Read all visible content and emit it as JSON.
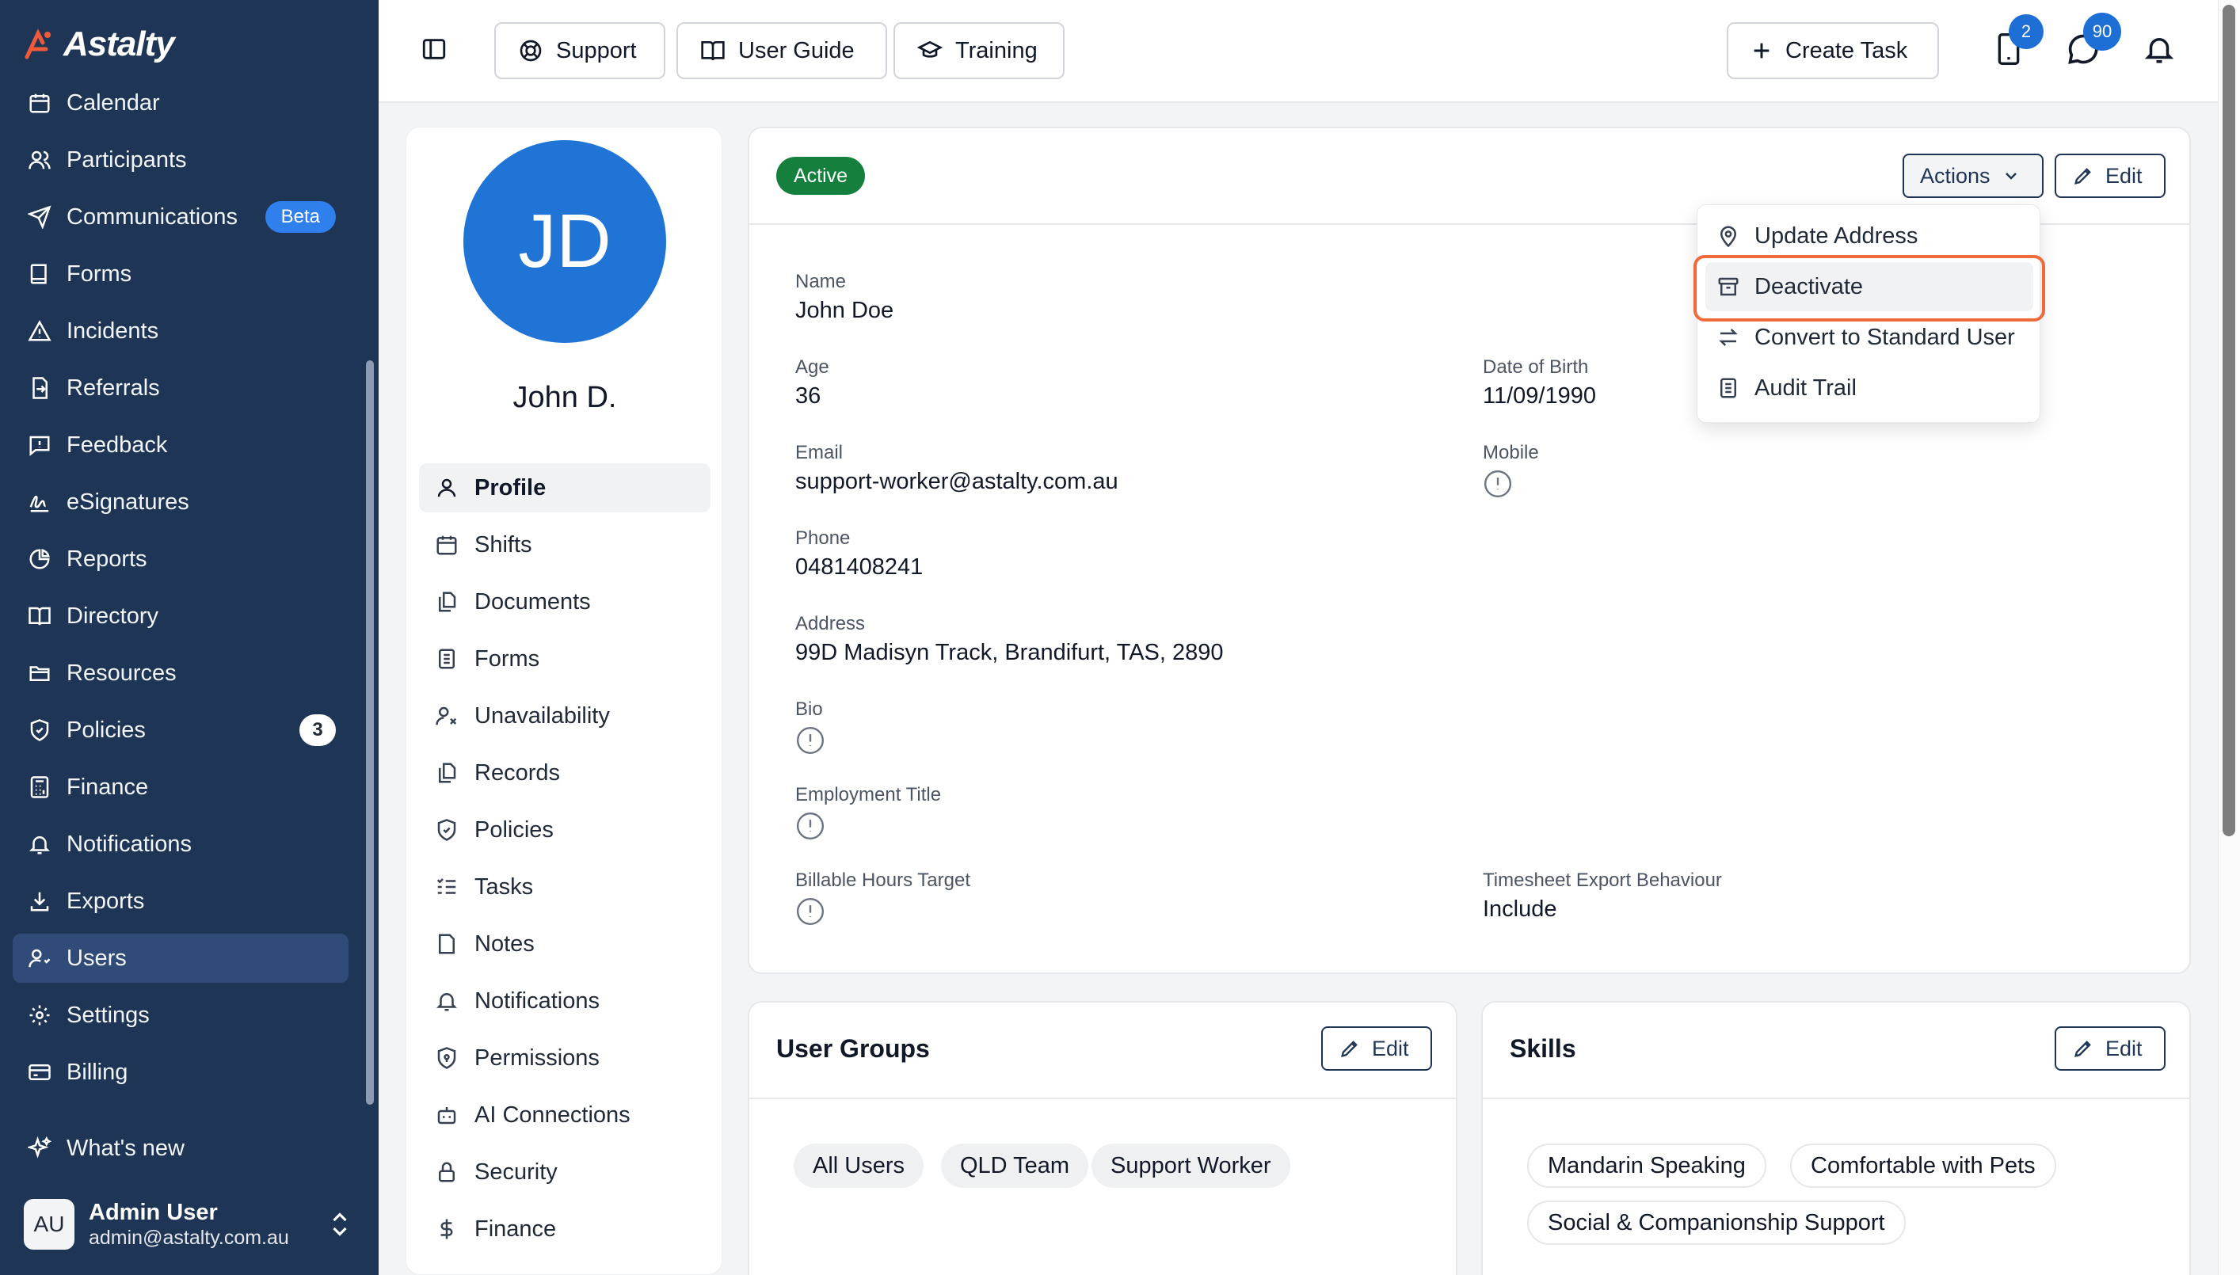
{
  "app": {
    "logo": "Astalty"
  },
  "sidebar": {
    "items": [
      {
        "label": "Calendar",
        "icon": "calendar-icon"
      },
      {
        "label": "Participants",
        "icon": "participants-icon"
      },
      {
        "label": "Communications",
        "icon": "send-icon",
        "badge": "Beta"
      },
      {
        "label": "Forms",
        "icon": "book-icon"
      },
      {
        "label": "Incidents",
        "icon": "warning-icon"
      },
      {
        "label": "Referrals",
        "icon": "referral-icon"
      },
      {
        "label": "Feedback",
        "icon": "feedback-icon"
      },
      {
        "label": "eSignatures",
        "icon": "signature-icon"
      },
      {
        "label": "Reports",
        "icon": "pie-chart-icon"
      },
      {
        "label": "Directory",
        "icon": "open-book-icon"
      },
      {
        "label": "Resources",
        "icon": "folder-icon"
      },
      {
        "label": "Policies",
        "icon": "shield-icon",
        "badge": "3"
      },
      {
        "label": "Finance",
        "icon": "calculator-icon"
      },
      {
        "label": "Notifications",
        "icon": "bell-icon"
      },
      {
        "label": "Exports",
        "icon": "download-icon"
      },
      {
        "label": "Users",
        "icon": "users-icon",
        "active": true
      },
      {
        "label": "Settings",
        "icon": "gear-icon"
      },
      {
        "label": "Billing",
        "icon": "credit-card-icon"
      }
    ],
    "whats_new": "What's new",
    "user": {
      "initials": "AU",
      "name": "Admin User",
      "email": "admin@astalty.com.au"
    }
  },
  "topbar": {
    "support": "Support",
    "user_guide": "User Guide",
    "training": "Training",
    "create_task": "Create Task",
    "tasks_count": "2",
    "messages_count": "90"
  },
  "profile": {
    "initials": "JD",
    "short_name": "John D.",
    "nav": [
      {
        "label": "Profile",
        "icon": "person-icon",
        "active": true
      },
      {
        "label": "Shifts",
        "icon": "calendar-icon"
      },
      {
        "label": "Documents",
        "icon": "documents-icon"
      },
      {
        "label": "Forms",
        "icon": "form-icon"
      },
      {
        "label": "Unavailability",
        "icon": "user-x-icon"
      },
      {
        "label": "Records",
        "icon": "records-icon"
      },
      {
        "label": "Policies",
        "icon": "shield-icon"
      },
      {
        "label": "Tasks",
        "icon": "tasks-icon"
      },
      {
        "label": "Notes",
        "icon": "note-icon"
      },
      {
        "label": "Notifications",
        "icon": "bell-icon"
      },
      {
        "label": "Permissions",
        "icon": "shield-lock-icon"
      },
      {
        "label": "AI Connections",
        "icon": "bot-icon"
      },
      {
        "label": "Security",
        "icon": "lock-icon"
      },
      {
        "label": "Finance",
        "icon": "dollar-icon"
      }
    ]
  },
  "details": {
    "status": "Active",
    "actions_label": "Actions",
    "edit_label": "Edit",
    "fields": {
      "name": {
        "label": "Name",
        "value": "John Doe"
      },
      "age": {
        "label": "Age",
        "value": "36"
      },
      "dob": {
        "label": "Date of Birth",
        "value": "11/09/1990"
      },
      "email": {
        "label": "Email",
        "value": "support-worker@astalty.com.au"
      },
      "mobile": {
        "label": "Mobile"
      },
      "phone": {
        "label": "Phone",
        "value": "0481408241"
      },
      "address": {
        "label": "Address",
        "value": "99D Madisyn Track, Brandifurt, TAS, 2890"
      },
      "bio": {
        "label": "Bio"
      },
      "employment_title": {
        "label": "Employment Title"
      },
      "billable_hours": {
        "label": "Billable Hours Target"
      },
      "timesheet_export": {
        "label": "Timesheet Export Behaviour",
        "value": "Include"
      }
    }
  },
  "actions_menu": {
    "items": [
      {
        "label": "Update Address",
        "icon": "map-pin-icon"
      },
      {
        "label": "Deactivate",
        "icon": "archive-icon",
        "highlighted": true
      },
      {
        "label": "Convert to Standard User",
        "icon": "swap-icon"
      },
      {
        "label": "Audit Trail",
        "icon": "document-list-icon"
      }
    ]
  },
  "user_groups": {
    "title": "User Groups",
    "edit_label": "Edit",
    "chips": [
      "All Users",
      "QLD Team",
      "Support Worker"
    ]
  },
  "skills": {
    "title": "Skills",
    "edit_label": "Edit",
    "chips": [
      "Mandarin Speaking",
      "Comfortable with Pets",
      "Social & Companionship Support"
    ]
  },
  "colors": {
    "sidebar_bg": "#1f3556",
    "sidebar_active": "#304b78",
    "accent_blue": "#1f74d6",
    "status_green": "#15803d",
    "highlight_outline": "#ef6a3a"
  }
}
